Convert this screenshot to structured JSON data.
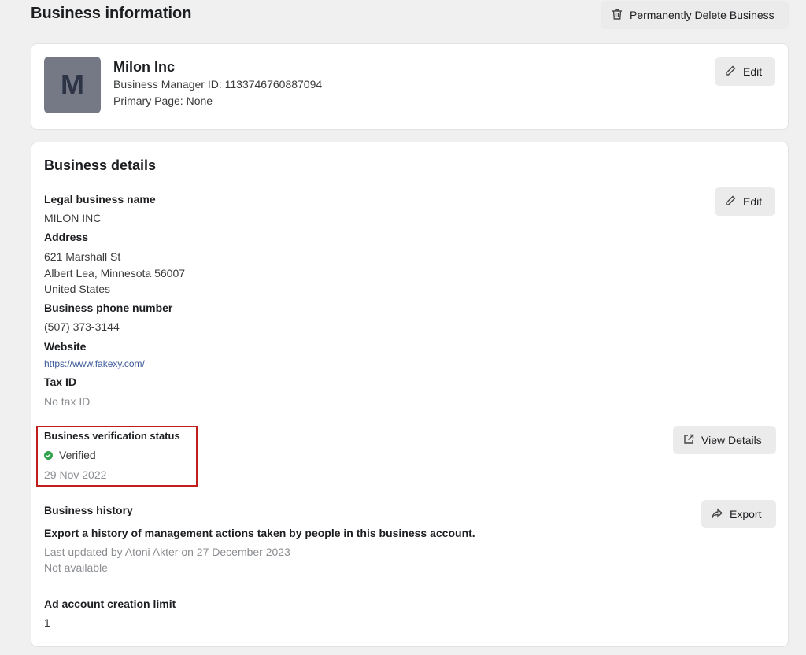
{
  "header": {
    "title": "Business information",
    "delete_label": "Permanently Delete Business"
  },
  "business": {
    "avatar_letter": "M",
    "name": "Milon Inc",
    "manager_id": "Business Manager ID: 1133746760887094",
    "primary_page": "Primary Page: None",
    "edit_label": "Edit"
  },
  "details": {
    "title": "Business details",
    "edit_label": "Edit",
    "legal_name_label": "Legal business name",
    "legal_name": "MILON INC",
    "address_label": "Address",
    "address_line1": "621 Marshall St",
    "address_line2": "Albert Lea, Minnesota 56007",
    "address_line3": "United States",
    "phone_label": "Business phone number",
    "phone": "(507) 373-3144",
    "website_label": "Website",
    "website": "https://www.fakexy.com/",
    "tax_label": "Tax ID",
    "tax": "No tax ID",
    "verification_label": "Business verification status",
    "verification_status": "Verified",
    "verification_date": "29 Nov 2022",
    "view_details_label": "View Details",
    "history_label": "Business history",
    "history_desc": "Export a history of management actions taken by people in this business account.",
    "history_updated": "Last updated by Atoni Akter on 27 December 2023",
    "history_availability": "Not available",
    "export_label": "Export",
    "ad_limit_label": "Ad account creation limit",
    "ad_limit": "1"
  },
  "icons": {
    "delete": "trash-icon",
    "edit": "pencil-icon",
    "view": "external-link-icon",
    "export": "share-arrow-icon",
    "verified": "check-circle-icon"
  },
  "colors": {
    "verified": "#31a24c",
    "highlight_box": "#c21d1d",
    "link": "#3c5a99",
    "avatar_bg": "#757985"
  }
}
